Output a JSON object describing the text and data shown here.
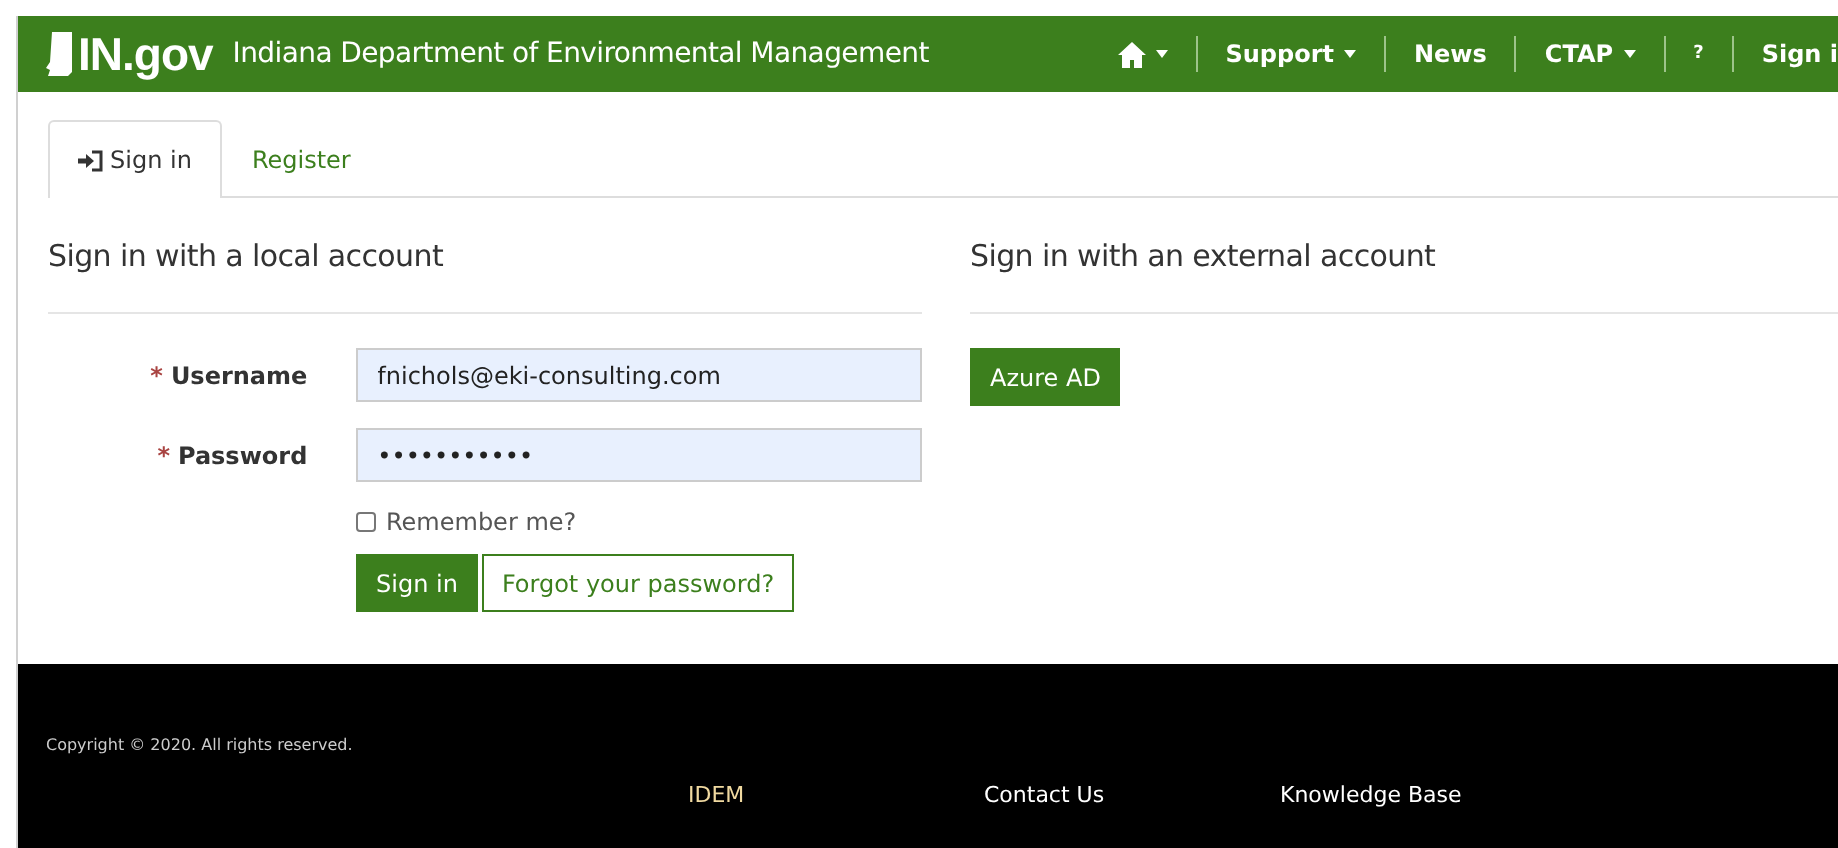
{
  "header": {
    "logo": "IN.gov",
    "title": "Indiana Department of Environmental Management",
    "nav": [
      {
        "kind": "home",
        "dropdown": true
      },
      {
        "kind": "text",
        "label": "Support",
        "dropdown": true
      },
      {
        "kind": "text",
        "label": "News",
        "dropdown": false
      },
      {
        "kind": "text",
        "label": "CTAP",
        "dropdown": true
      },
      {
        "kind": "small",
        "label": "?",
        "dropdown": false
      },
      {
        "kind": "text",
        "label": "Sign i",
        "dropdown": false
      }
    ]
  },
  "tabs": [
    {
      "label": "Sign in",
      "kind": "icon",
      "selected": true
    },
    {
      "label": "Register",
      "kind": "plain",
      "selected": false
    }
  ],
  "local": {
    "heading": "Sign in with a local account",
    "fields": [
      {
        "label": "Username",
        "required": "*",
        "value": "fnichols@eki-consulting.com"
      },
      {
        "label": "Password",
        "required": "*",
        "value": "•••••••••••"
      }
    ],
    "remember": {
      "label": "Remember me?",
      "checked": false
    },
    "buttons": [
      {
        "label": "Sign in",
        "kind": "primary"
      },
      {
        "label": "Forgot your password?",
        "kind": "outline"
      }
    ]
  },
  "external": {
    "heading": "Sign in with an external account",
    "buttons": [
      {
        "label": "Azure AD"
      }
    ]
  },
  "footer": {
    "copyright": "Copyright © 2020. All rights reserved.",
    "links": [
      "IDEM",
      "Contact Us",
      "Knowledge Base"
    ]
  }
}
